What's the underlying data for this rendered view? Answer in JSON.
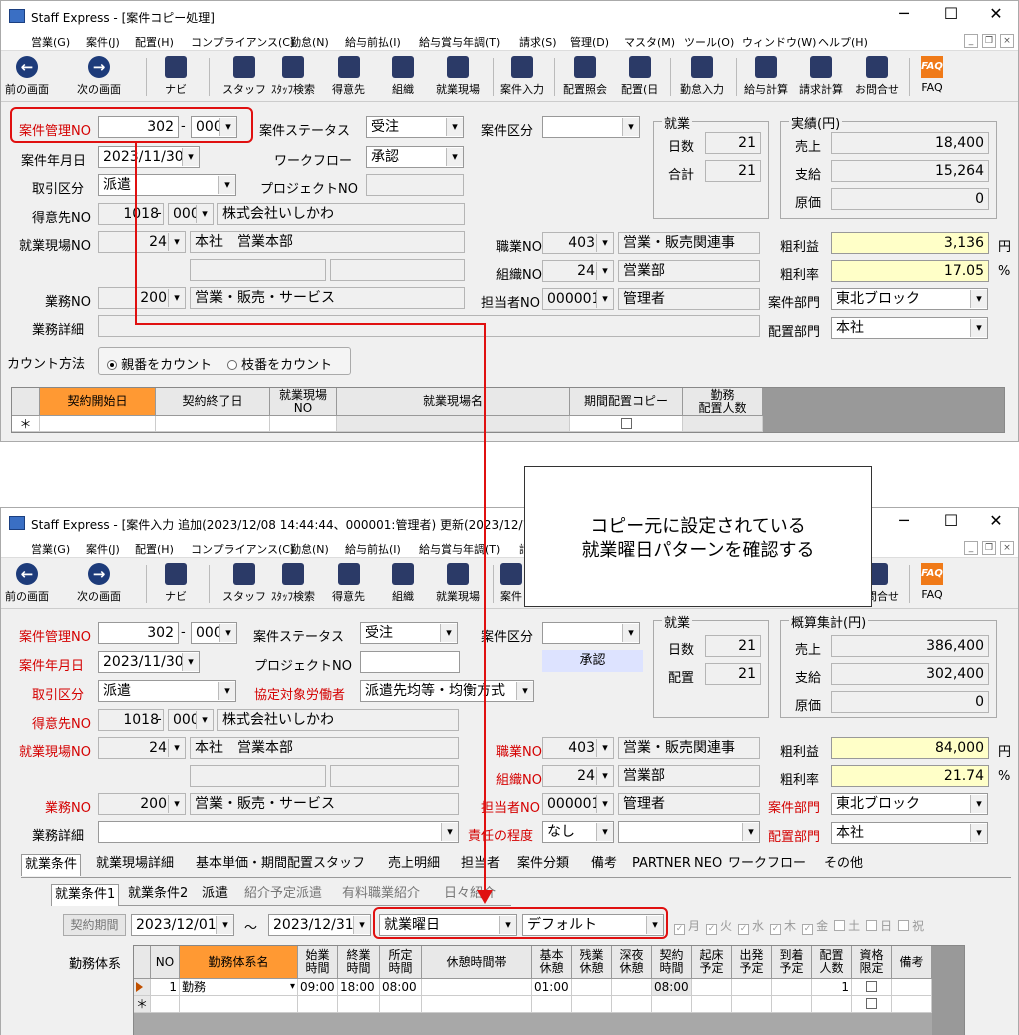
{
  "win1": {
    "title": "Staff Express - [案件コピー処理]",
    "menu": [
      "営業(G)",
      "案件(J)",
      "配置(H)",
      "コンプライアンス(C)",
      "勤怠(N)",
      "給与前払(I)",
      "給与賞与年調(T)",
      "請求(S)",
      "管理(D)",
      "マスタ(M)",
      "ツール(O)",
      "ウィンドウ(W)",
      "ヘルプ(H)"
    ],
    "toolbar": [
      "前の画面",
      "次の画面",
      "ナビ",
      "スタッフ",
      "ｽﾀｯﾌ検索",
      "得意先",
      "組織",
      "就業現場",
      "案件入力",
      "配置照会",
      "配置(日",
      "勤怠入力",
      "給与計算",
      "請求計算",
      "お問合せ",
      "FAQ"
    ],
    "case_no_label": "案件管理NO",
    "case_no": "302",
    "case_branch": "000",
    "case_status_label": "案件ステータス",
    "case_status": "受注",
    "case_type_label": "案件区分",
    "case_date_label": "案件年月日",
    "case_date": "2023/11/30",
    "workflow_label": "ワークフロー",
    "workflow": "承認",
    "deal_type_label": "取引区分",
    "deal_type": "派遣",
    "project_label": "プロジェクトNO",
    "client_label": "得意先NO",
    "client_no": "1018",
    "client_branch": "000",
    "client_name": "株式会社いしかわ",
    "site_label": "就業現場NO",
    "site_no": "24",
    "site_name": "本社　営業本部",
    "job_label": "職業NO",
    "job_no": "403",
    "job_name": "営業・販売関連事",
    "org_label": "組織NO",
    "org_no": "24",
    "org_name": "営業部",
    "work_label": "業務NO",
    "work_no": "200",
    "work_name": "営業・販売・サービス",
    "staff_label": "担当者NO",
    "staff_no": "000001",
    "staff_name": "管理者",
    "detail_label": "業務詳細",
    "dept_label": "案件部門",
    "dept": "東北ブロック",
    "place_dept_label": "配置部門",
    "place_dept": "本社",
    "count_label": "カウント方法",
    "radio1": "親番をカウント",
    "radio2": "枝番をカウント",
    "employment_group": "就業",
    "days_label": "日数",
    "days": "21",
    "total_label": "合計",
    "total": "21",
    "results_group": "実績(円)",
    "sales_label": "売上",
    "sales": "18,400",
    "pay_label": "支給",
    "pay": "15,264",
    "cost_label": "原価",
    "cost": "0",
    "gross_label": "粗利益",
    "gross": "3,136",
    "gross_unit": "円",
    "rate_label": "粗利率",
    "rate": "17.05",
    "rate_unit": "%",
    "grid_headers": [
      "契約開始日",
      "契約終了日",
      "就業現場\nNO",
      "就業現場名",
      "期間配置コピー",
      "勤務\n配置人数"
    ],
    "grid_new_row": "＊"
  },
  "win2": {
    "title": "Staff Express - [案件入力 追加(2023/12/08 14:44:44、000001:管理者) 更新(2023/12/18 16:29:31、",
    "menu": [
      "営業(G)",
      "案件(J)",
      "配置(H)",
      "コンプライアンス(C)",
      "勤怠(N)",
      "給与前払(I)",
      "給与賞与年調(T)",
      "請"
    ],
    "toolbar": [
      "前の画面",
      "次の画面",
      "ナビ",
      "スタッフ",
      "ｽﾀｯﾌ検索",
      "得意先",
      "組織",
      "就業現場",
      "案件",
      "お問合せ",
      "FAQ"
    ],
    "case_no_label": "案件管理NO",
    "case_no": "302",
    "case_branch": "000",
    "case_status_label": "案件ステータス",
    "case_status": "受注",
    "case_type_label": "案件区分",
    "case_date_label": "案件年月日",
    "case_date": "2023/11/30",
    "project_label": "プロジェクトNO",
    "approval": "承認",
    "deal_type_label": "取引区分",
    "deal_type": "派遣",
    "agreement_label": "協定対象労働者",
    "agreement": "派遣先均等・均衡方式",
    "client_label": "得意先NO",
    "client_no": "1018",
    "client_branch": "000",
    "client_name": "株式会社いしかわ",
    "site_label": "就業現場NO",
    "site_no": "24",
    "site_name": "本社　営業本部",
    "job_label": "職業NO",
    "job_no": "403",
    "job_name": "営業・販売関連事",
    "org_label": "組織NO",
    "org_no": "24",
    "org_name": "営業部",
    "work_label": "業務NO",
    "work_no": "200",
    "work_name": "営業・販売・サービス",
    "staff_label": "担当者NO",
    "staff_no": "000001",
    "staff_name": "管理者",
    "detail_label": "業務詳細",
    "resp_label": "責任の程度",
    "resp": "なし",
    "dept_label": "案件部門",
    "dept": "東北ブロック",
    "place_dept_label": "配置部門",
    "place_dept": "本社",
    "employment_group": "就業",
    "days_label": "日数",
    "days": "21",
    "place_label": "配置",
    "place": "21",
    "summary_group": "概算集計(円)",
    "sales_label": "売上",
    "sales": "386,400",
    "pay_label": "支給",
    "pay": "302,400",
    "cost_label": "原価",
    "cost": "0",
    "gross_label": "粗利益",
    "gross": "84,000",
    "gross_unit": "円",
    "rate_label": "粗利率",
    "rate": "21.74",
    "rate_unit": "%",
    "tabs": [
      "就業条件",
      "就業現場詳細",
      "基本単価・期間配置スタッフ",
      "売上明細",
      "担当者",
      "案件分類",
      "備考",
      "PARTNER",
      "NEO",
      "ワークフロー",
      "その他"
    ],
    "subtabs": [
      "就業条件1",
      "就業条件2",
      "派遣",
      "紹介予定派遣",
      "有料職業紹介",
      "日々紹介"
    ],
    "period_btn": "契約期間",
    "period_from": "2023/12/01",
    "tilde": "～",
    "period_to": "2023/12/31",
    "weekday_type": "就業曜日",
    "weekday_pattern": "デフォルト",
    "days_of_week": [
      "月",
      "火",
      "水",
      "木",
      "金",
      "土",
      "日",
      "祝"
    ],
    "days_checked": [
      true,
      true,
      true,
      true,
      true,
      false,
      false,
      false
    ],
    "shift_label": "勤務体系",
    "grid_headers": [
      "NO",
      "勤務体系名",
      "始業\n時間",
      "終業\n時間",
      "所定\n時間",
      "休憩時間帯",
      "基本\n休憩",
      "残業\n休憩",
      "深夜\n休憩",
      "契約\n時間",
      "起床\n予定",
      "出発\n予定",
      "到着\n予定",
      "配置\n人数",
      "資格\n限定",
      "備考"
    ],
    "row": {
      "no": "1",
      "name": "勤務",
      "start": "09:00",
      "end": "18:00",
      "fixed": "08:00",
      "basic_break": "01:00",
      "contract": "08:00",
      "people": "1"
    },
    "grid_new_row": "＊"
  },
  "callout": {
    "line1": "コピー元に設定されている",
    "line2": "就業曜日パターンを確認する"
  },
  "window_controls": {
    "min": "─",
    "max": "☐",
    "close": "✕"
  },
  "mdi_controls": {
    "min": "_",
    "restore": "❐",
    "close": "×"
  },
  "colors": {
    "highlight": "#e01010",
    "header_orange": "#ff9933",
    "yellow_field": "#ffffc8",
    "required_label": "#d40000"
  }
}
